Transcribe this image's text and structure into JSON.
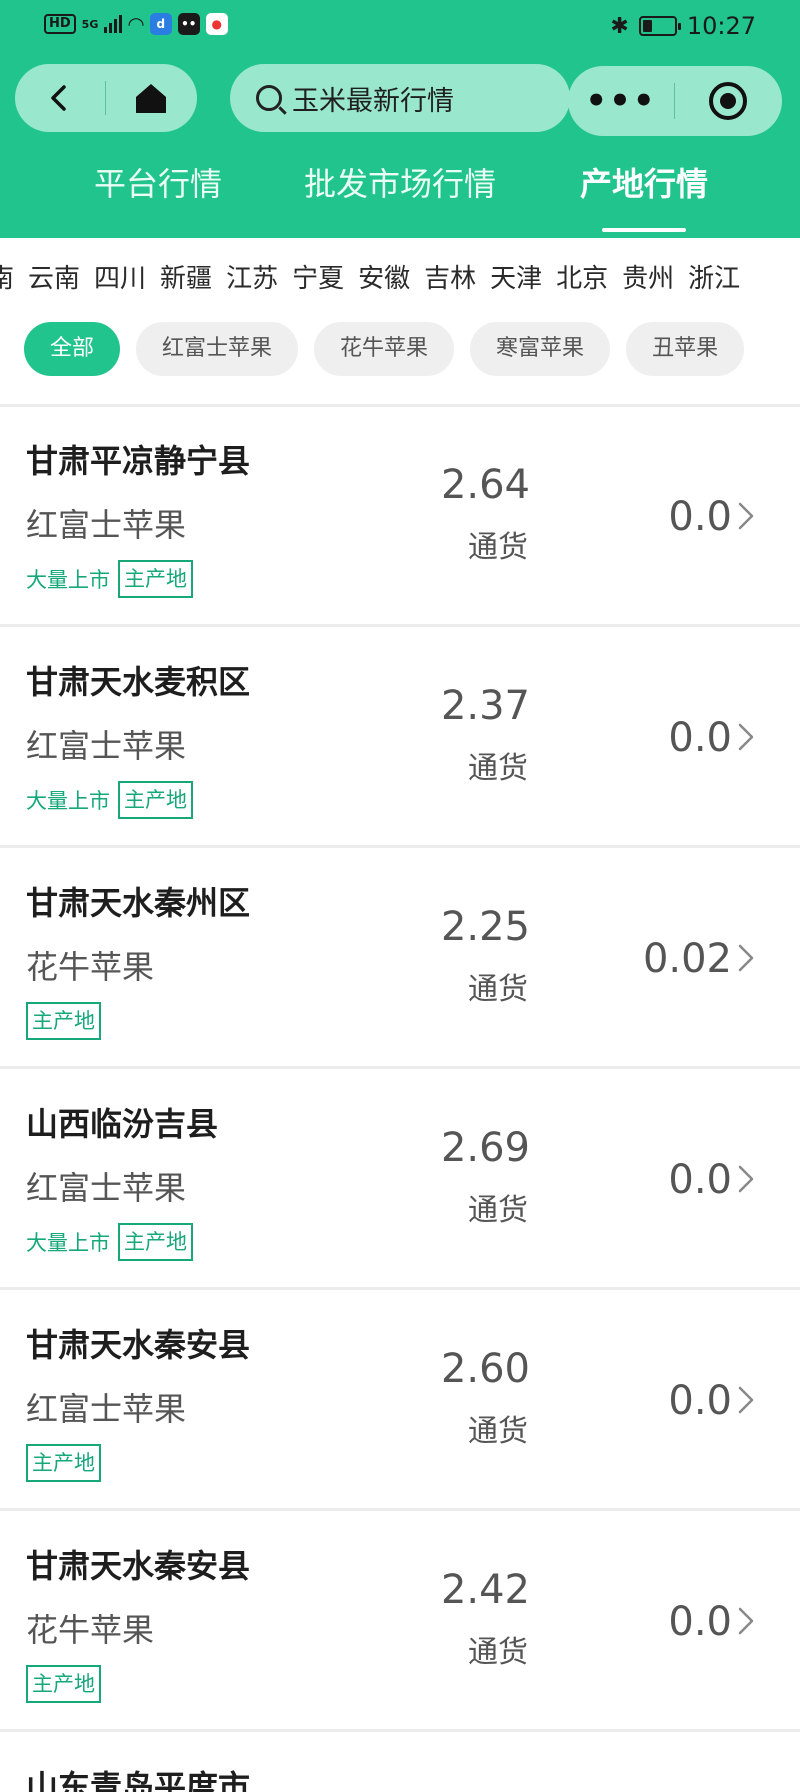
{
  "status_bar": {
    "network_hd": "HD",
    "network_gen": "5G",
    "bluetooth_icon": "bluetooth-icon",
    "battery_level": 0.3,
    "time": "10:27"
  },
  "nav": {
    "search_text": "玉米最新行情",
    "menu_dots": "•••"
  },
  "tabs": [
    {
      "label": "平台行情",
      "active": false
    },
    {
      "label": "批发市场行情",
      "active": false
    },
    {
      "label": "产地行情",
      "active": true
    }
  ],
  "provinces": [
    "南",
    "云南",
    "四川",
    "新疆",
    "江苏",
    "宁夏",
    "安徽",
    "吉林",
    "天津",
    "北京",
    "贵州",
    "浙江"
  ],
  "chips": [
    {
      "label": "全部",
      "active": true
    },
    {
      "label": "红富士苹果",
      "active": false
    },
    {
      "label": "花牛苹果",
      "active": false
    },
    {
      "label": "寒富苹果",
      "active": false
    },
    {
      "label": "丑苹果",
      "active": false
    }
  ],
  "rows": [
    {
      "region": "甘肃平凉静宁县",
      "variety": "红富士苹果",
      "tag_text": "大量上市",
      "tag_box": "主产地",
      "price": "2.64",
      "grade": "通货",
      "change": "0.0"
    },
    {
      "region": "甘肃天水麦积区",
      "variety": "红富士苹果",
      "tag_text": "大量上市",
      "tag_box": "主产地",
      "price": "2.37",
      "grade": "通货",
      "change": "0.0"
    },
    {
      "region": "甘肃天水秦州区",
      "variety": "花牛苹果",
      "tag_text": "",
      "tag_box": "主产地",
      "price": "2.25",
      "grade": "通货",
      "change": "0.02"
    },
    {
      "region": "山西临汾吉县",
      "variety": "红富士苹果",
      "tag_text": "大量上市",
      "tag_box": "主产地",
      "price": "2.69",
      "grade": "通货",
      "change": "0.0"
    },
    {
      "region": "甘肃天水秦安县",
      "variety": "红富士苹果",
      "tag_text": "",
      "tag_box": "主产地",
      "price": "2.60",
      "grade": "通货",
      "change": "0.0"
    },
    {
      "region": "甘肃天水秦安县",
      "variety": "花牛苹果",
      "tag_text": "",
      "tag_box": "主产地",
      "price": "2.42",
      "grade": "通货",
      "change": "0.0"
    }
  ],
  "partial_row": {
    "region": "山东青岛平度市"
  },
  "colors": {
    "accent": "#21c48d",
    "tag": "#17a87a"
  }
}
